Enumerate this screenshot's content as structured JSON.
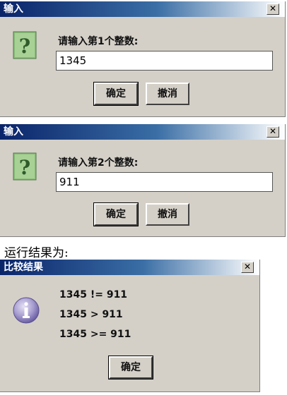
{
  "dialog1": {
    "title": "输入",
    "close": "✕",
    "prompt": "请输入第1个整数:",
    "value": "1345",
    "ok": "确定",
    "cancel": "撤消"
  },
  "dialog2": {
    "title": "输入",
    "close": "✕",
    "prompt": "请输入第2个整数:",
    "value": "911",
    "ok": "确定",
    "cancel": "撤消"
  },
  "caption": "运行结果为:",
  "dialog3": {
    "title": "比较结果",
    "close": "✕",
    "lines": [
      "1345 != 911",
      "1345 > 911",
      "1345 >= 911"
    ],
    "ok": "确定"
  },
  "icons": {
    "question": "question-icon",
    "info": "info-icon"
  }
}
